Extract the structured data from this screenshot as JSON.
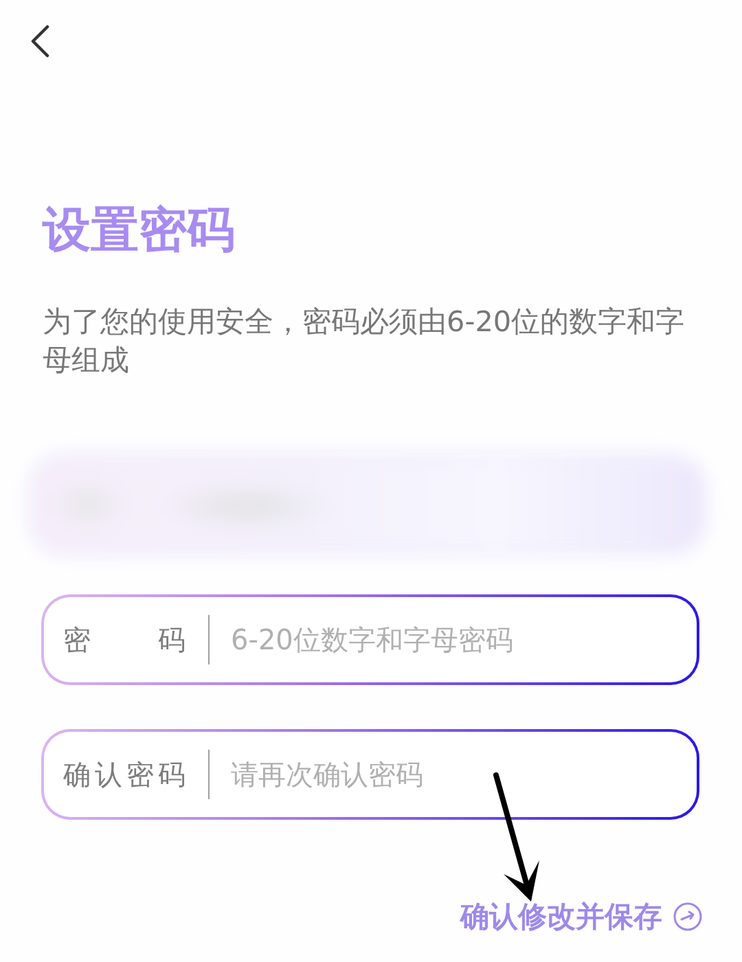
{
  "title": "设置密码",
  "description": "为了您的使用安全，密码必须由6-20位的数字和字母组成",
  "fields": [
    {
      "kind": "blurred"
    },
    {
      "kind": "input",
      "label": "密 码",
      "placeholder": "6-20位数字和字母密码"
    },
    {
      "kind": "input",
      "label": "确认密码",
      "placeholder": "请再次确认密码"
    }
  ],
  "submit": {
    "label": "确认修改并保存"
  }
}
